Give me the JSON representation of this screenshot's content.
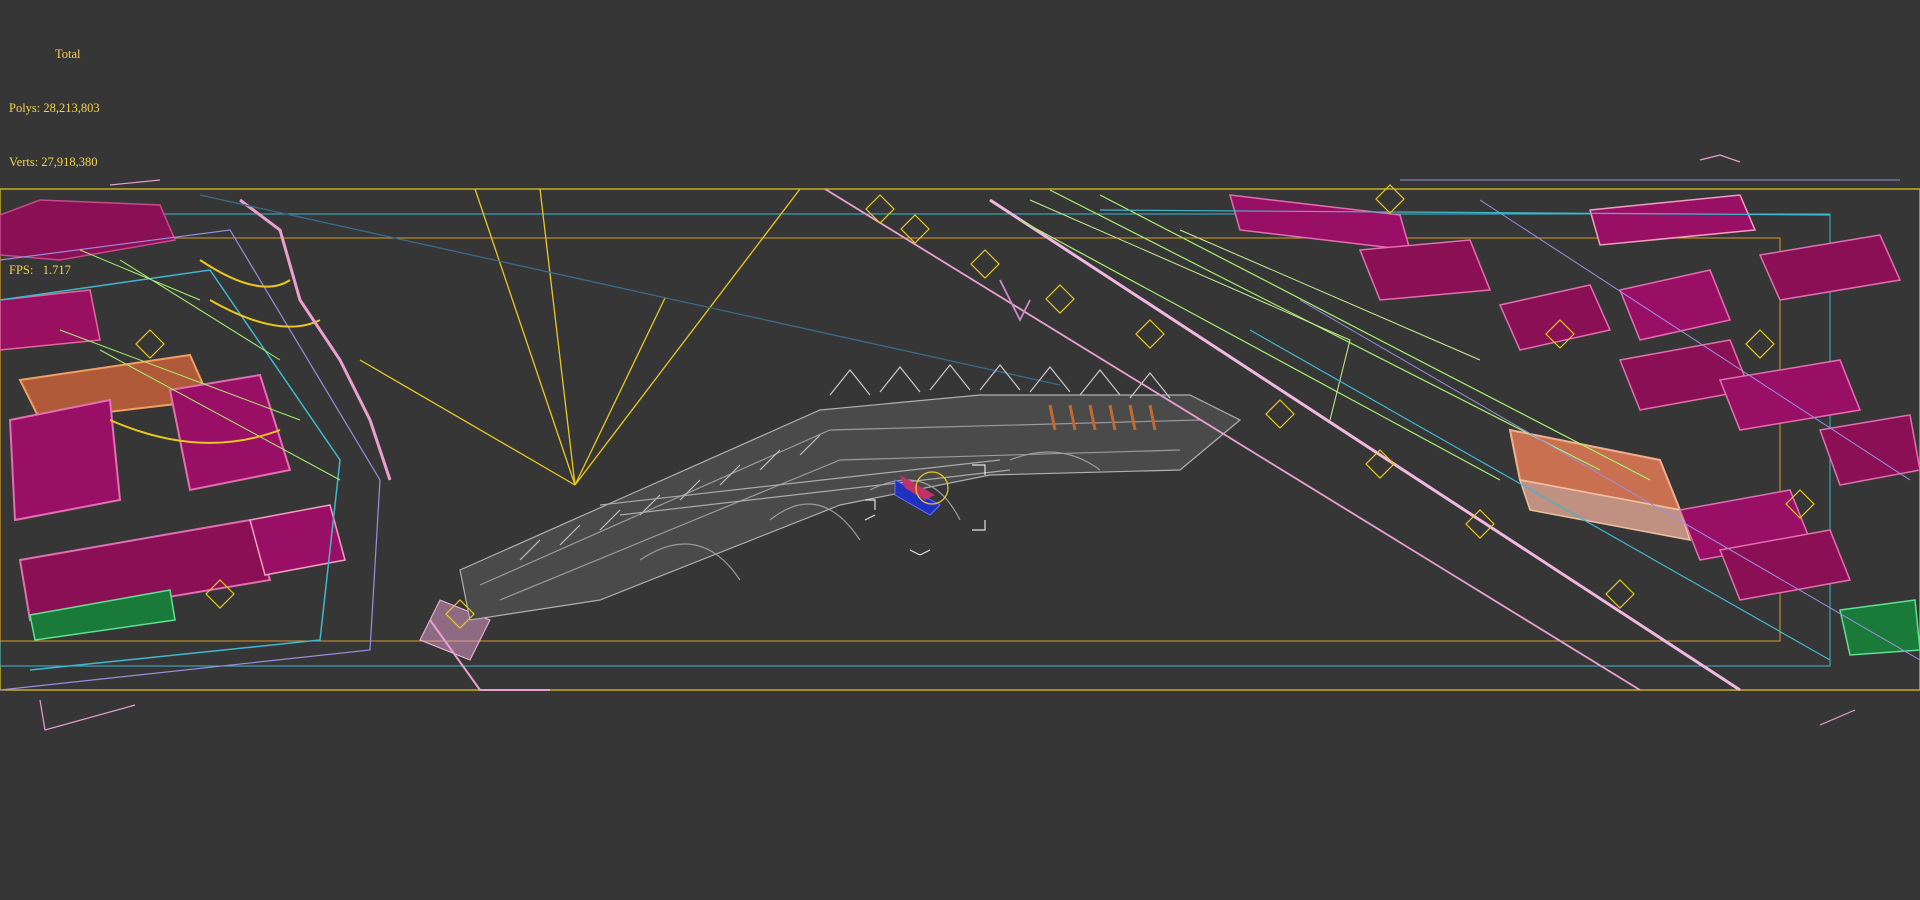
{
  "viewport": {
    "background": "#363636",
    "stats": {
      "title": "Total",
      "polys_label": "Polys:",
      "polys_value": "28,213,803",
      "verts_label": "Verts:",
      "verts_value": "27,918,380",
      "fps_label": "FPS:",
      "fps_value": "1.717"
    },
    "colors": {
      "stats_text": "#f2d34a",
      "frame_yellow": "#e8c820",
      "frame_cyan": "#3fb8d0",
      "frame_orange": "#d89a2a",
      "roof_magenta": "#a0106a",
      "wire_green": "#a8f070",
      "wire_lavender": "#9a8ee0",
      "bridge_gray": "#9a9a9a",
      "pink_line": "#e8a0d0"
    }
  }
}
